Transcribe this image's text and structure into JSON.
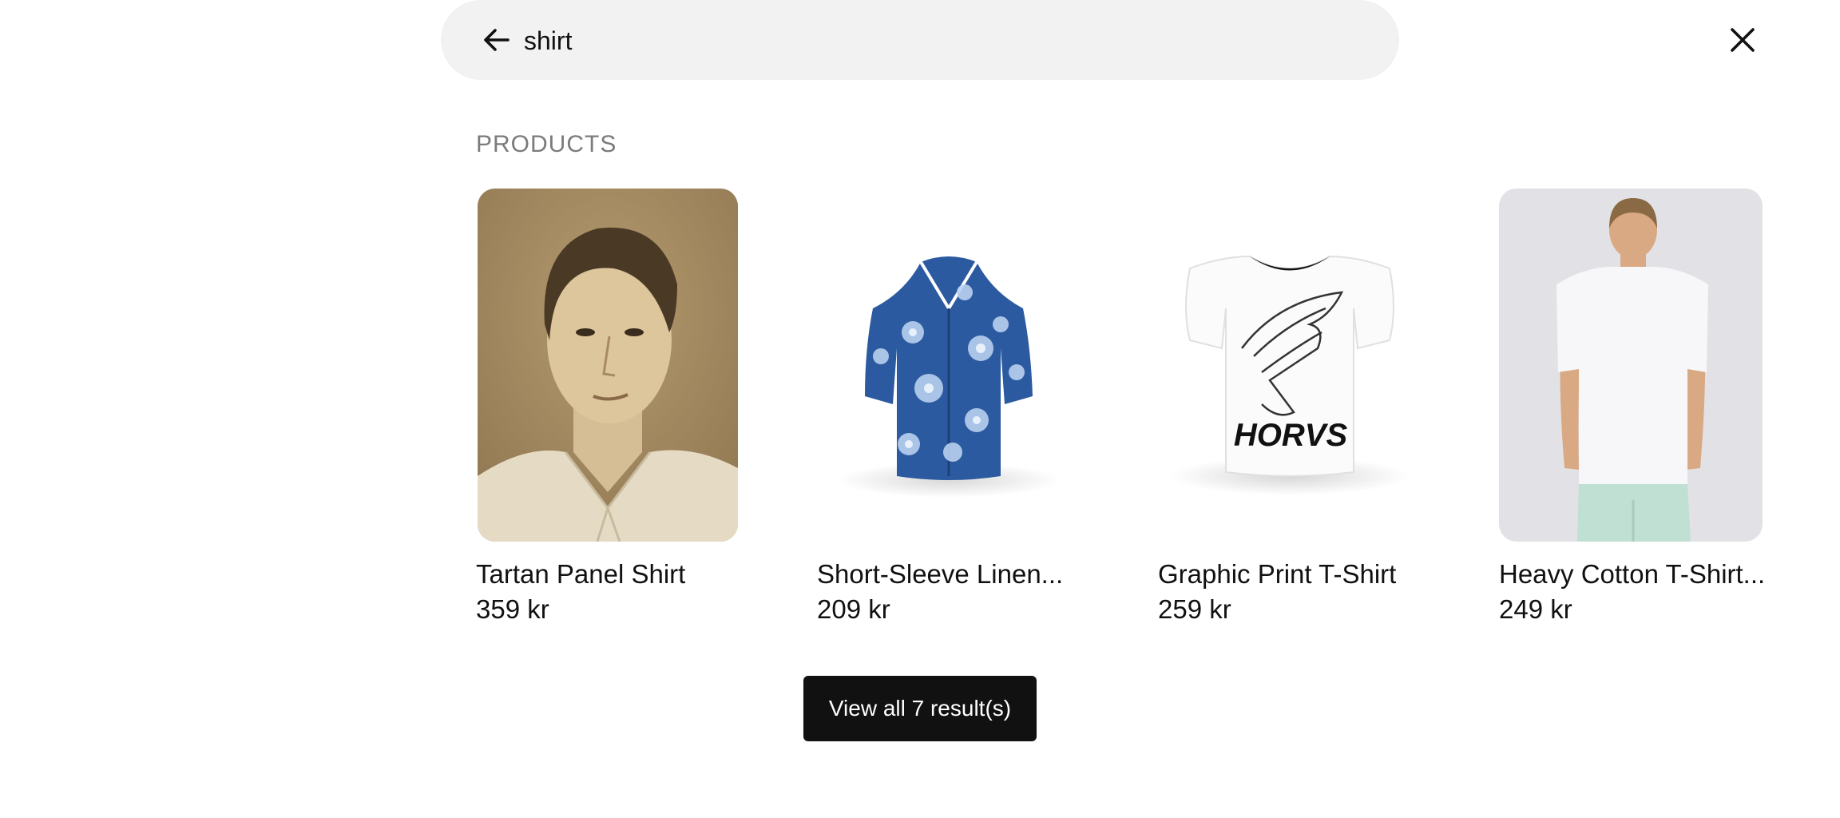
{
  "search": {
    "value": "shirt",
    "back_icon": "arrow-left-icon",
    "close_icon": "close-icon"
  },
  "products_section": {
    "title": "PRODUCTS",
    "items": [
      {
        "name": "Tartan Panel Shirt",
        "price": "359 kr",
        "image": "sepia portrait photo"
      },
      {
        "name": "Short-Sleeve Linen...",
        "price": "209 kr",
        "image": "blue floral short-sleeve shirt"
      },
      {
        "name": "Graphic Print T-Shirt",
        "price": "259 kr",
        "image": "white graphic print t-shirt"
      },
      {
        "name": "Heavy Cotton T-Shirt...",
        "price": "249 kr",
        "image": "man in white t-shirt, back view"
      }
    ]
  },
  "view_all_label": "View all 7 result(s)",
  "colors": {
    "search_bg": "#f2f2f3",
    "button_bg": "#111111",
    "section_title": "#7b7b7b"
  }
}
